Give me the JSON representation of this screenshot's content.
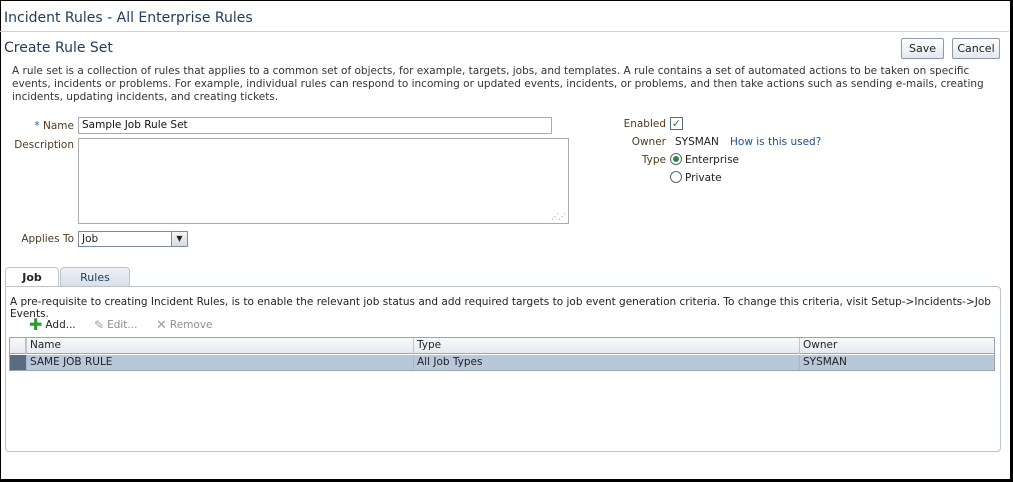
{
  "window": {
    "title": "Incident Rules - All Enterprise Rules"
  },
  "page": {
    "title": "Create Rule Set"
  },
  "actions": {
    "save": "Save",
    "cancel": "Cancel"
  },
  "intro": "A rule set is a collection of rules that applies to a common set of objects, for example, targets, jobs, and templates. A rule contains a set of automated actions to be taken on specific events, incidents or problems. For example, individual rules can respond to incoming or updated events, incidents, or problems, and then take actions such as sending e-mails, creating incidents, updating incidents, and creating tickets.",
  "form": {
    "name_required_marker": "*",
    "name_label": "Name",
    "name_value": "Sample Job Rule Set",
    "description_label": "Description",
    "description_value": "",
    "applies_to_label": "Applies To",
    "applies_to_value": "Job",
    "enabled_label": "Enabled",
    "enabled_checked": true,
    "owner_label": "Owner",
    "owner_value": "SYSMAN",
    "owner_help_link": "How is this used?",
    "type_label": "Type",
    "type_options": [
      {
        "label": "Enterprise",
        "selected": true
      },
      {
        "label": "Private",
        "selected": false
      }
    ]
  },
  "tabs": [
    {
      "label": "Job",
      "active": true
    },
    {
      "label": "Rules",
      "active": false
    }
  ],
  "job_tab": {
    "prerequisite_text": "A pre-requisite to creating Incident Rules, is to enable the relevant job status and add required targets to job event generation criteria. To change this criteria, visit Setup->Incidents->Job Events.",
    "toolbar": {
      "add": "Add...",
      "edit": "Edit...",
      "remove": "Remove"
    },
    "table": {
      "columns": [
        "Name",
        "Type",
        "Owner"
      ],
      "rows": [
        {
          "name": "SAME JOB RULE",
          "type": "All Job Types",
          "owner": "SYSMAN"
        }
      ]
    }
  },
  "icons": {
    "add": "plus-icon",
    "edit": "pencil-icon",
    "remove": "x-icon",
    "select": "chevron-down-icon",
    "enabled": "check-icon"
  }
}
